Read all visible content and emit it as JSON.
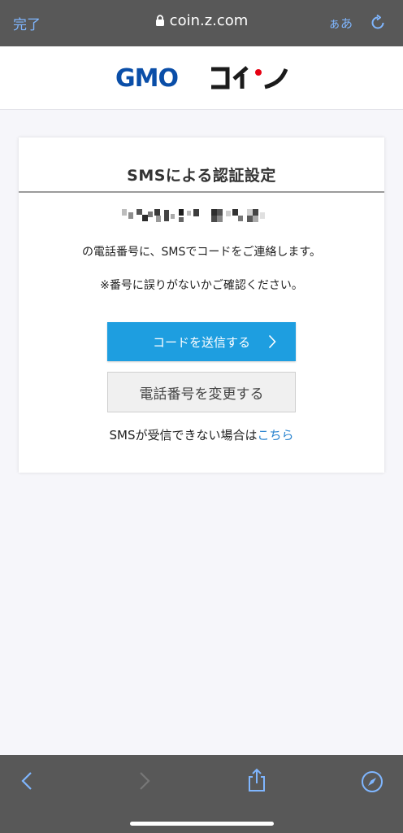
{
  "browser": {
    "done_label": "完了",
    "url": "coin.z.com",
    "text_size_label": "ぁあ",
    "icons": [
      "lock-icon",
      "reload-icon",
      "back-icon",
      "forward-icon",
      "share-icon",
      "compass-icon"
    ]
  },
  "brand": {
    "logo_text": "GMOコイン",
    "logo_colors": {
      "gmo": "#0a4ea8",
      "coin": "#1b1b1b",
      "accent": "#e60012"
    }
  },
  "card": {
    "title": "SMSによる認証設定",
    "phone_note": "の電話番号に、SMSでコードをご連絡します。",
    "confirm_note": "※番号に誤りがないかご確認ください。",
    "send_button": "コードを送信する",
    "change_button": "電話番号を変更する",
    "help_text": "SMSが受信できない場合は",
    "help_link": "こちら"
  },
  "colors": {
    "primary": "#1e9ee0",
    "link": "#2a84cf",
    "toolbar_accent": "#7fb6ff"
  }
}
